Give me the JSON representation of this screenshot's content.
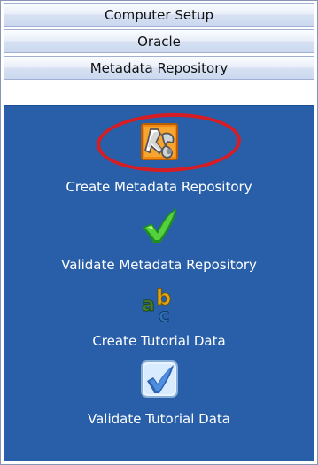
{
  "sections": {
    "computer_setup": "Computer Setup",
    "oracle": "Oracle",
    "metadata_repository": "Metadata Repository"
  },
  "items": [
    {
      "label": "Create Metadata Repository",
      "icon": "tools-icon"
    },
    {
      "label": "Validate Metadata Repository",
      "icon": "checkmark-icon"
    },
    {
      "label": "Create Tutorial Data",
      "icon": "abc-letters-icon"
    },
    {
      "label": "Validate Tutorial Data",
      "icon": "check-box-icon"
    }
  ],
  "colors": {
    "panel_background": "#285fa8",
    "highlight": "#d61d24"
  }
}
